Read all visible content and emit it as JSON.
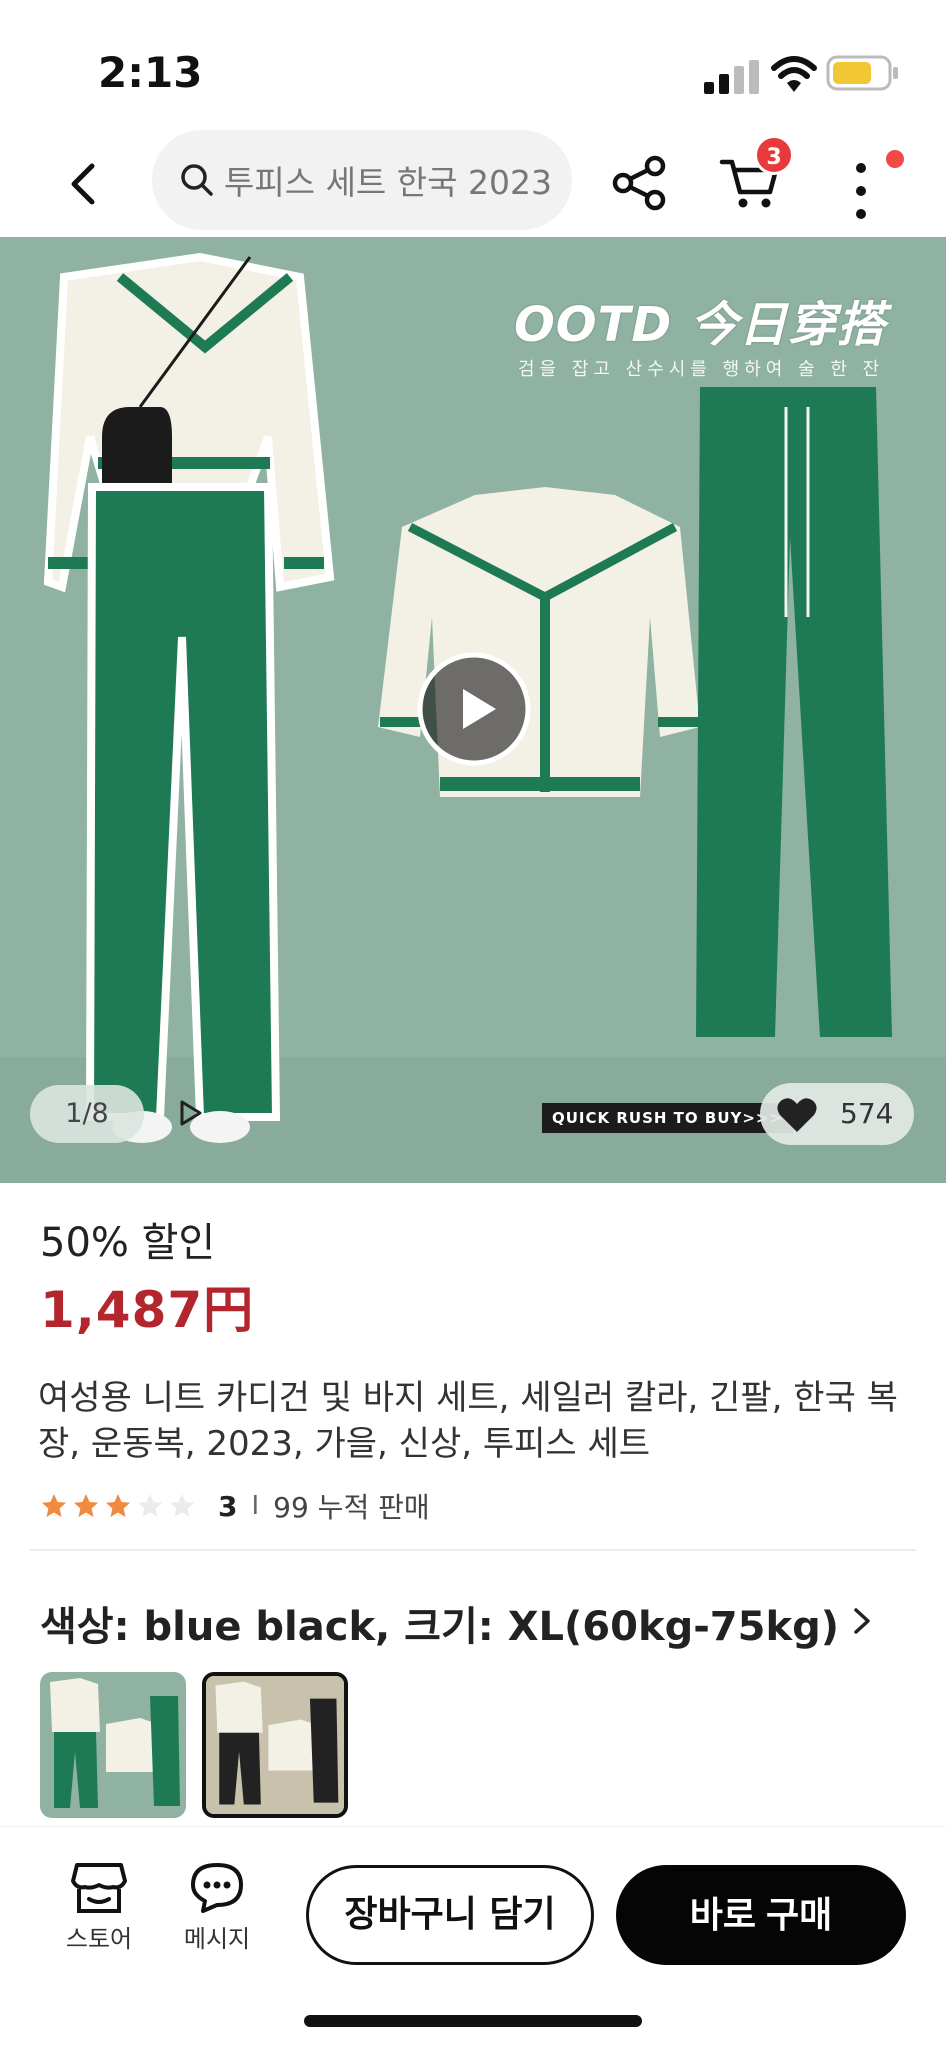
{
  "status_bar": {
    "time": "2:13"
  },
  "header": {
    "search_placeholder": "투피스 세트 한국 2023",
    "cart_count": "3"
  },
  "hero": {
    "banner_title": "OOTD 今日穿搭",
    "banner_subtitle": "검을 잡고 산수시를 행하여 술 한 잔",
    "quick_label": "QUICK RUSH TO BUY>>>",
    "image_counter": "1/8",
    "like_count": "574"
  },
  "product": {
    "discount": "50% 할인",
    "price": "1,487円",
    "title": "여성용 니트 카디건 및 바지 세트, 세일러 칼라, 긴팔, 한국 복장, 운동복, 2023, 가을, 신상, 투피스 세트",
    "rating": 3,
    "rating_label": "3",
    "separator": "I",
    "sold": "99 누적 판매",
    "selection": "색상: blue black, 크기: XL(60kg-75kg)"
  },
  "variants": [
    {
      "name": "green",
      "selected": false
    },
    {
      "name": "blue black",
      "selected": true
    }
  ],
  "bottom_bar": {
    "store_label": "스토어",
    "message_label": "메시지",
    "add_to_cart": "장바구니 담기",
    "buy_now": "바로 구매"
  },
  "colors": {
    "price_red": "#b3262e",
    "badge_red": "#e83a3a",
    "hero_green": "#8fb2a2",
    "garment_green": "#1e7a55",
    "star_orange": "#f08a3c"
  }
}
